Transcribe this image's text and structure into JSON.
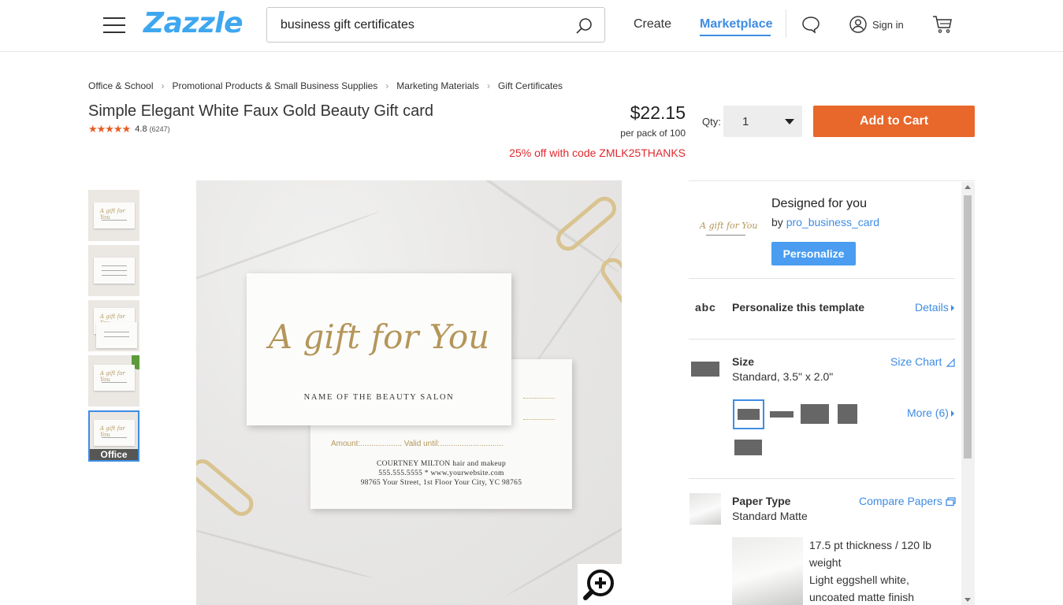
{
  "header": {
    "logo": "Zazzle",
    "search_value": "business gift certificates",
    "nav_create": "Create",
    "nav_marketplace": "Marketplace",
    "sign_in": "Sign in",
    "accent_color": "#3e8ce4"
  },
  "breadcrumb": [
    "Office & School",
    "Promotional Products & Small Business Supplies",
    "Marketing Materials",
    "Gift Certificates"
  ],
  "product": {
    "title": "Simple Elegant White Faux Gold Beauty Gift card",
    "stars": "★★★★★",
    "rating": "4.8",
    "review_count": "(6247)",
    "price": "$22.15",
    "per_pack": "per pack of 100",
    "promo": "25% off with code ZMLK25THANKS",
    "qty_label": "Qty:",
    "qty_value": "1",
    "add_to_cart": "Add to Cart"
  },
  "thumbnails": {
    "selected_label": "Office"
  },
  "preview": {
    "gift_text": "A gift for You",
    "salon_name": "NAME OF THE BEAUTY SALON",
    "amount_line": "Amount:................... Valid until:.............................",
    "contact_name": "COURTNEY MILTON hair and makeup",
    "contact_phone": "555.555.5555 * www.yourwebsite.com",
    "contact_address": "98765 Your Street, 1st Floor Your City, YC 98765"
  },
  "panel": {
    "designed_title": "Designed for you",
    "designed_by_prefix": "by ",
    "designer": "pro_business_card",
    "personalize": "Personalize",
    "abc": "abc",
    "personalize_template": "Personalize this template",
    "details": "Details",
    "size_title": "Size",
    "size_value": "Standard, 3.5\" x 2.0\"",
    "size_chart": "Size Chart",
    "more": "More (6)",
    "paper_title": "Paper Type",
    "paper_value": "Standard Matte",
    "compare_papers": "Compare Papers",
    "paper_desc_1": "17.5 pt thickness / 120 lb weight",
    "paper_desc_2": "Light eggshell white, uncoated matte finish"
  }
}
